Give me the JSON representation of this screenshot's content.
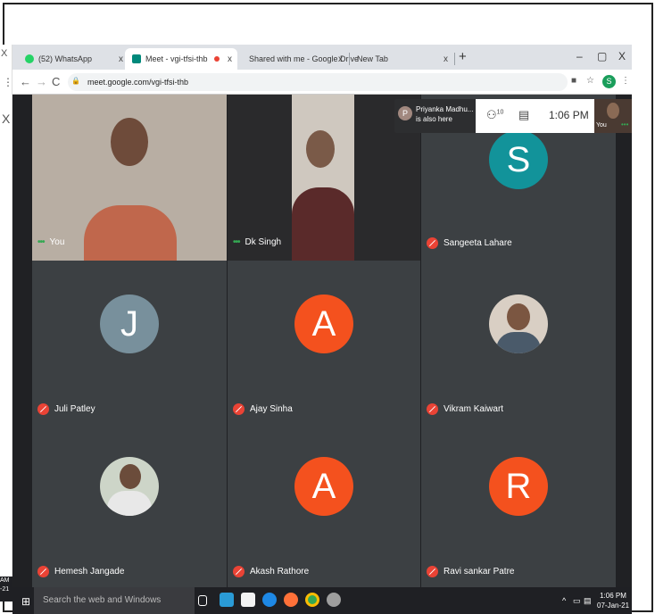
{
  "browser": {
    "tabs": [
      {
        "label": "(52) WhatsApp",
        "close": "x",
        "favicon": "whatsapp-icon",
        "color": "#25d366"
      },
      {
        "label": "Meet - vgi-tfsi-thb",
        "close": "x",
        "favicon": "meet-icon",
        "color": "#00897b"
      },
      {
        "label": "Shared with me - Google Drive",
        "close": "x",
        "favicon": "drive-icon",
        "color": "#fbbc04"
      },
      {
        "label": "New Tab",
        "close": "x",
        "favicon": "",
        "color": ""
      }
    ],
    "new_tab": "+",
    "recording_dot_color": "#ea4335",
    "url": "meet.google.com/vgi-tfsi-thb",
    "profile_initial": "S",
    "window": {
      "minimize": "–",
      "restore": "▢",
      "close": "X"
    }
  },
  "left_strip": {
    "close": "X",
    "menu": "⋮",
    "close2": "X",
    "clock_top": "AM",
    "clock_bottom": "-21"
  },
  "meet": {
    "participants": [
      {
        "name": "You",
        "indicator": "dots",
        "avatar": "",
        "avatar_color": "",
        "type": "video"
      },
      {
        "name": "Dk Singh",
        "indicator": "dots",
        "avatar": "",
        "avatar_color": "",
        "type": "video"
      },
      {
        "name": "Sangeeta Lahare",
        "indicator": "muted",
        "avatar": "S",
        "avatar_color": "#12939a",
        "type": "avatar"
      },
      {
        "name": "Juli Patley",
        "indicator": "muted",
        "avatar": "J",
        "avatar_color": "#78909c",
        "type": "avatar"
      },
      {
        "name": "Ajay Sinha",
        "indicator": "muted",
        "avatar": "A",
        "avatar_color": "#f4511e",
        "type": "avatar"
      },
      {
        "name": "Vikram Kaiwart",
        "indicator": "muted",
        "avatar": "",
        "avatar_color": "",
        "type": "photo"
      },
      {
        "name": "Hemesh Jangade",
        "indicator": "muted",
        "avatar": "",
        "avatar_color": "",
        "type": "photo"
      },
      {
        "name": "Akash Rathore",
        "indicator": "muted",
        "avatar": "A",
        "avatar_color": "#f4511e",
        "type": "avatar"
      },
      {
        "name": "Ravi sankar Patre",
        "indicator": "muted",
        "avatar": "R",
        "avatar_color": "#f4511e",
        "type": "avatar"
      }
    ],
    "notice": {
      "initial": "P",
      "line1": "Priyanka Madhu...",
      "line2": "is also here"
    },
    "info": {
      "people_count": "10",
      "time": "1:06 PM"
    },
    "self_label": "You"
  },
  "taskbar": {
    "search_placeholder": "Search the web and Windows",
    "clock_time": "1:06 PM",
    "clock_date": "07-Jan-21",
    "tray": "^"
  }
}
